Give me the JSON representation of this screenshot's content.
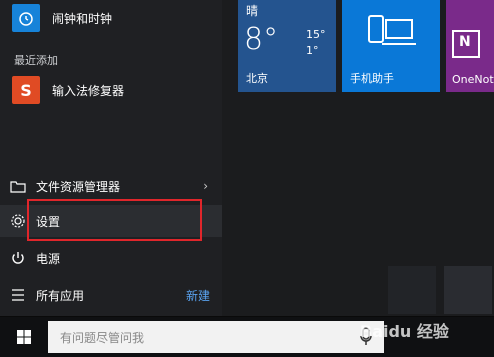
{
  "start_menu": {
    "top_app_label": "闹钟和时钟",
    "recently_added_header": "最近添加",
    "recent_app_label": "输入法修复器",
    "nav": {
      "file_explorer_label": "文件资源管理器",
      "settings_label": "设置",
      "power_label": "电源",
      "all_apps_label": "所有应用",
      "new_badge": "新建"
    }
  },
  "tiles": {
    "weather": {
      "condition": "晴",
      "temp": "8°",
      "high": "15°",
      "low": "1°",
      "city": "北京"
    },
    "phone_companion_label": "手机助手",
    "onenote_label": "OneNote"
  },
  "taskbar": {
    "search_placeholder": "有问题尽管问我"
  },
  "watermark": "Baidu 经验"
}
